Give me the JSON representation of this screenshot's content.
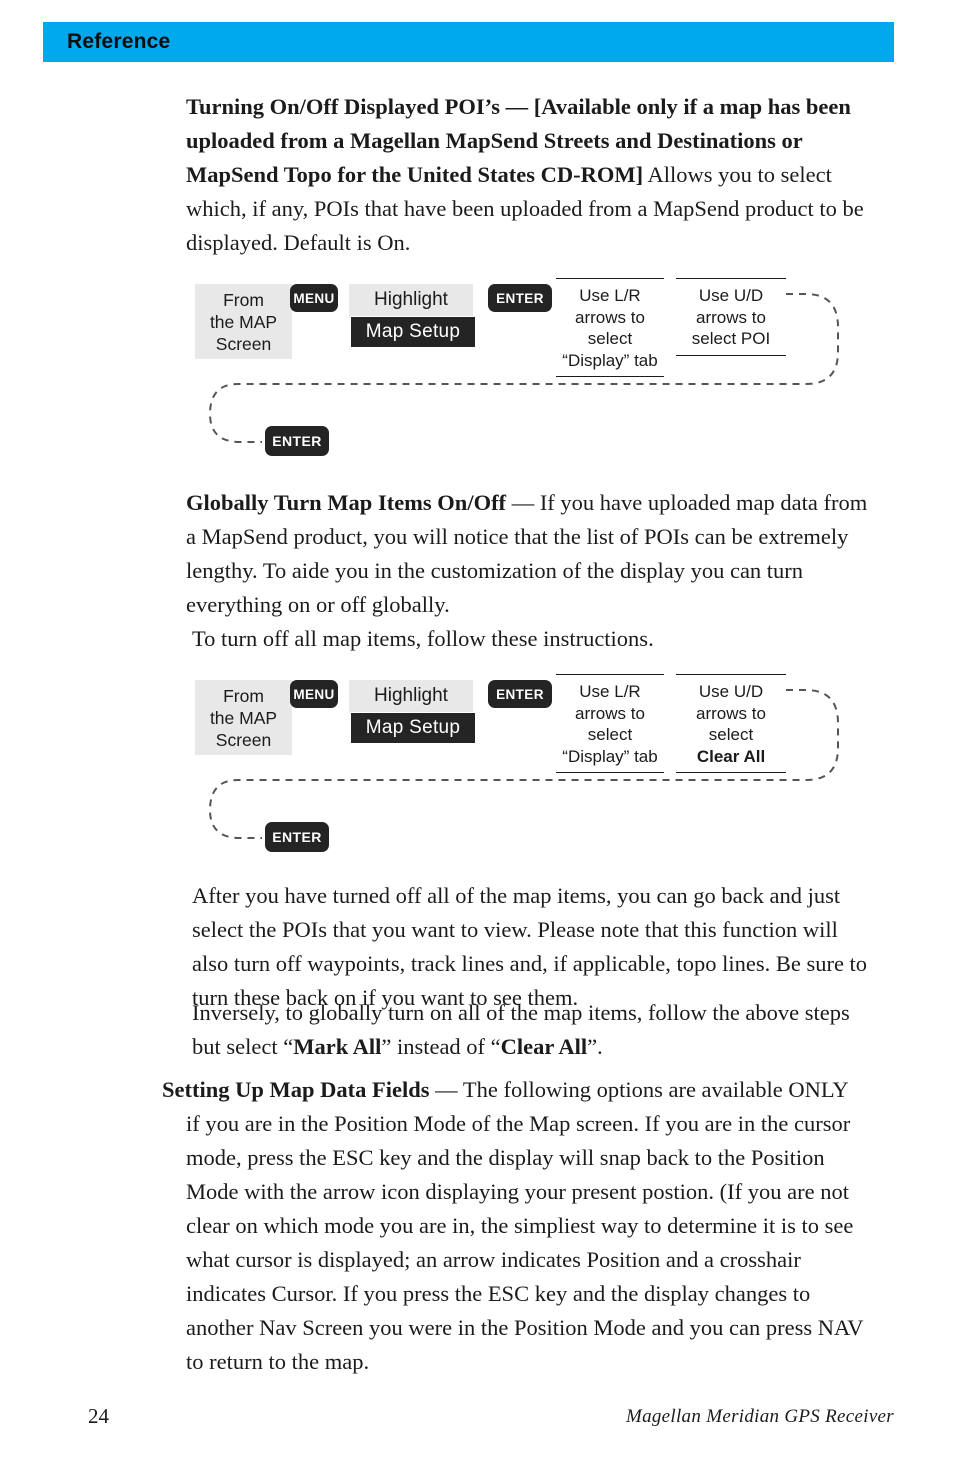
{
  "header": {
    "title": "Reference",
    "accent_color": "#00a8ec"
  },
  "paragraphs": {
    "poi_heading": "Turning On/Off Displayed POI’s — ",
    "poi_bracket": "[Available only if a map has been uploaded from a Magellan MapSend Streets and Destinations or MapSend Topo for the United States CD-ROM]",
    "poi_body": "  Allows you to select which, if any, POIs that have been uploaded from a MapSend product to be displayed.  Default is On.",
    "globally_heading": "Globally Turn Map Items On/Off",
    "globally_body": " — If you have uploaded map data from a MapSend product, you will notice that the list of POIs can be extremely lengthy.  To aide you in the customization of the display you can turn everything on or off globally.",
    "turn_off_all": "To turn off all map items, follow these instructions.",
    "after_body": "After you have turned off all of the map items, you can go back and just select the POIs that you want to view.  Please note that this function will also turn off waypoints, track lines and, if applicable, topo lines.  Be sure to turn these back on if you want to see them.",
    "inversely_pre": "Inversely, to globally turn on all of the map items, follow the above steps but select “",
    "inversely_mark_all": "Mark All",
    "inversely_mid": "” instead of “",
    "inversely_clear_all": "Clear All",
    "inversely_post": "”.",
    "setting_heading": "Setting Up Map Data Fields",
    "setting_body": " — The following options are available ONLY",
    "setting_rest": "if you are in the Position Mode of the Map screen.  If you are in the cursor mode, press the ESC key and the display will snap back to the Position Mode with the arrow icon displaying your present postion.  (If you are not clear on which mode you are in, the simpliest way to determine it is to see what cursor is displayed; an arrow indicates Position and a crosshair indicates Cursor.  If you press the ESC key and the display changes to another Nav Screen you were in the Position Mode and you can press NAV to return to the map."
  },
  "diagram1": {
    "from_screen": "From\nthe MAP\nScreen",
    "from_screen_l1": "From",
    "from_screen_l2": "the MAP",
    "from_screen_l3": "Screen",
    "key_menu": "MENU",
    "highlight": "Highlight",
    "map_setup": "Map Setup",
    "key_enter_top": "ENTER",
    "note_lr_l1": "Use L/R",
    "note_lr_l2": "arrows to",
    "note_lr_l3": "select",
    "note_lr_l4": "“Display” tab",
    "note_ud_l1": "Use U/D",
    "note_ud_l2": "arrows to",
    "note_ud_l3": "select POI",
    "key_enter_bottom": "ENTER"
  },
  "diagram2": {
    "from_screen_l1": "From",
    "from_screen_l2": "the MAP",
    "from_screen_l3": "Screen",
    "key_menu": "MENU",
    "highlight": "Highlight",
    "map_setup": "Map Setup",
    "key_enter_top": "ENTER",
    "note_lr_l1": "Use L/R",
    "note_lr_l2": "arrows to",
    "note_lr_l3": "select",
    "note_lr_l4": "“Display” tab",
    "note_ud_l1": "Use U/D",
    "note_ud_l2": "arrows to",
    "note_ud_l3": "select",
    "note_ud_l4": "Clear All",
    "key_enter_bottom": "ENTER"
  },
  "footer": {
    "page_number": "24",
    "book_title": "Magellan Meridian GPS Receiver"
  }
}
